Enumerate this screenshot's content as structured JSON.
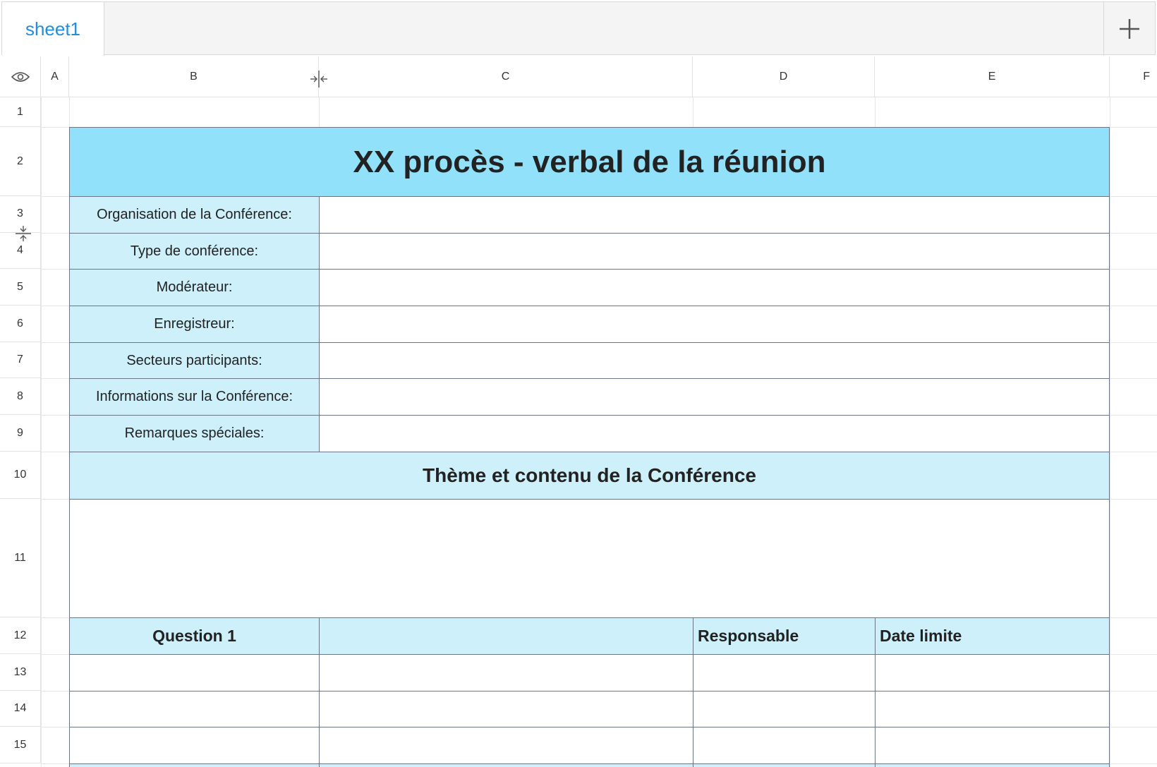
{
  "tabs": {
    "sheet_label": "sheet1"
  },
  "columns": [
    "A",
    "B",
    "C",
    "D",
    "E",
    "F"
  ],
  "rows": [
    "1",
    "2",
    "3",
    "4",
    "5",
    "6",
    "7",
    "8",
    "9",
    "10",
    "11",
    "12",
    "13",
    "14",
    "15"
  ],
  "sheet": {
    "title": "XX procès - verbal de la réunion",
    "labels": [
      "Organisation de la Conférence:",
      "Type de conférence:",
      "Modérateur:",
      "Enregistreur:",
      "Secteurs participants:",
      "Informations sur la Conférence:",
      "Remarques spéciales:"
    ],
    "section_title": "Thème et contenu de la Conférence",
    "question_header": "Question 1",
    "responsible_header": "Responsable",
    "deadline_header": "Date limite"
  },
  "colors": {
    "title_fill": "#91e1fb",
    "label_fill": "#cdf0fb",
    "tab_text": "#1e8fe0",
    "border": "#6b7489"
  },
  "icons": [
    "plus-icon",
    "eye-icon",
    "column-resize-icon",
    "row-resize-icon"
  ]
}
